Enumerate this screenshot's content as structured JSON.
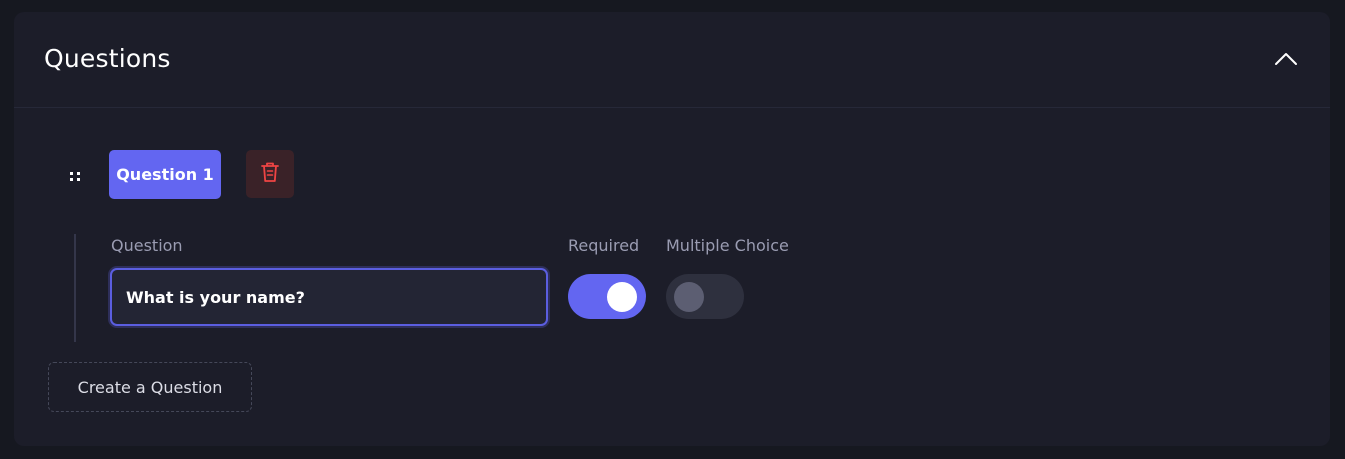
{
  "panel": {
    "title": "Questions",
    "collapse_icon": "chevron-up-icon"
  },
  "question": {
    "chip_label": "Question 1",
    "drag_icon": "drag-handle-icon",
    "delete_icon": "trash-icon",
    "fields": {
      "question_label": "Question",
      "question_value": "What is your name?",
      "required_label": "Required",
      "required_on": true,
      "multiple_choice_label": "Multiple Choice",
      "multiple_choice_on": false
    }
  },
  "actions": {
    "create_label": "Create a Question"
  },
  "colors": {
    "accent": "#6366f1",
    "delete": "#ef4444",
    "panel_bg": "#1c1d29",
    "page_bg": "#161820"
  }
}
